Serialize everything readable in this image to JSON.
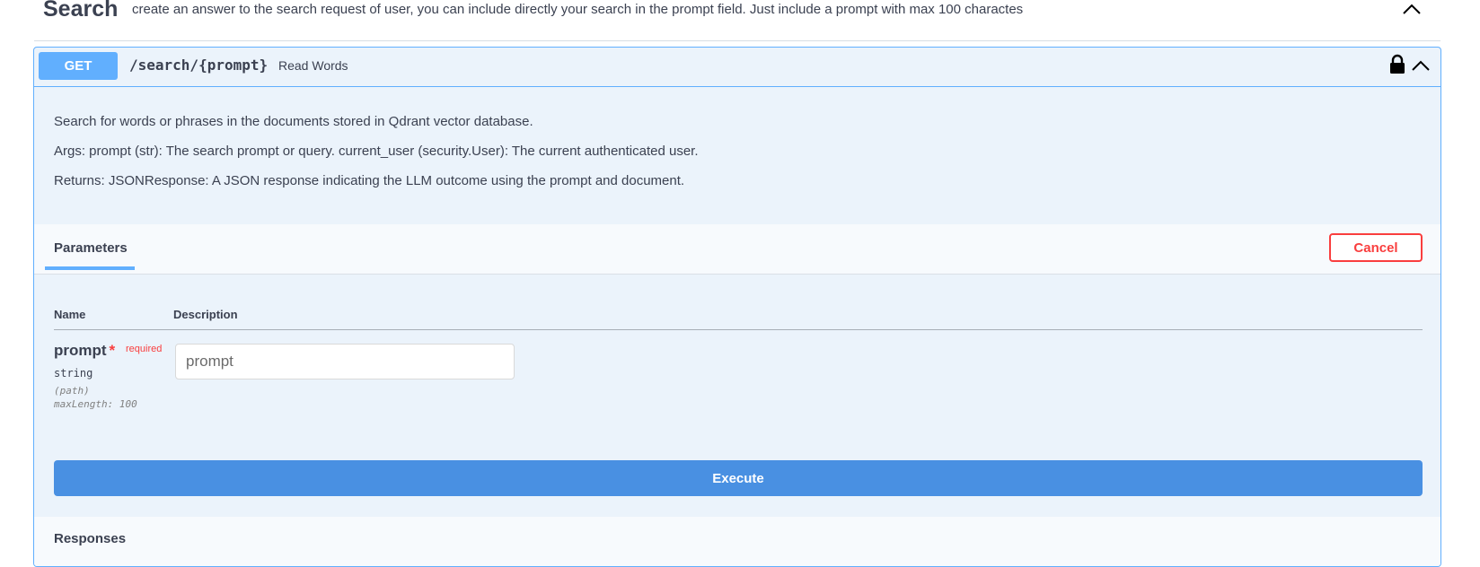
{
  "tag": {
    "title": "Search",
    "description": "create an answer to the search request of user, you can include directly your search in the prompt field. Just include a prompt with max 100 charactes"
  },
  "operation": {
    "method": "GET",
    "path": "/search/{prompt}",
    "summary": "Read Words",
    "description_lines": [
      "Search for words or phrases in the documents stored in Qdrant vector database.",
      "Args: prompt (str): The search prompt or query. current_user (security.User): The current authenticated user.",
      "Returns: JSONResponse: A JSON response indicating the LLM outcome using the prompt and document."
    ]
  },
  "parameters": {
    "tab_label": "Parameters",
    "cancel_label": "Cancel",
    "col_name": "Name",
    "col_description": "Description",
    "items": [
      {
        "name": "prompt",
        "star": "*",
        "required_label": "required",
        "type": "string",
        "location": "(path)",
        "max_length": "maxLength: 100",
        "placeholder": "prompt"
      }
    ]
  },
  "execute_label": "Execute",
  "responses_label": "Responses",
  "icons": {
    "tag_chevron": "chevron-up-icon",
    "lock": "lock-icon",
    "collapse": "chevron-up-icon"
  },
  "colors": {
    "get": "#61affe",
    "opblock_bg": "#ebf3fb",
    "execute": "#4990e2",
    "cancel": "#f93e3e"
  }
}
